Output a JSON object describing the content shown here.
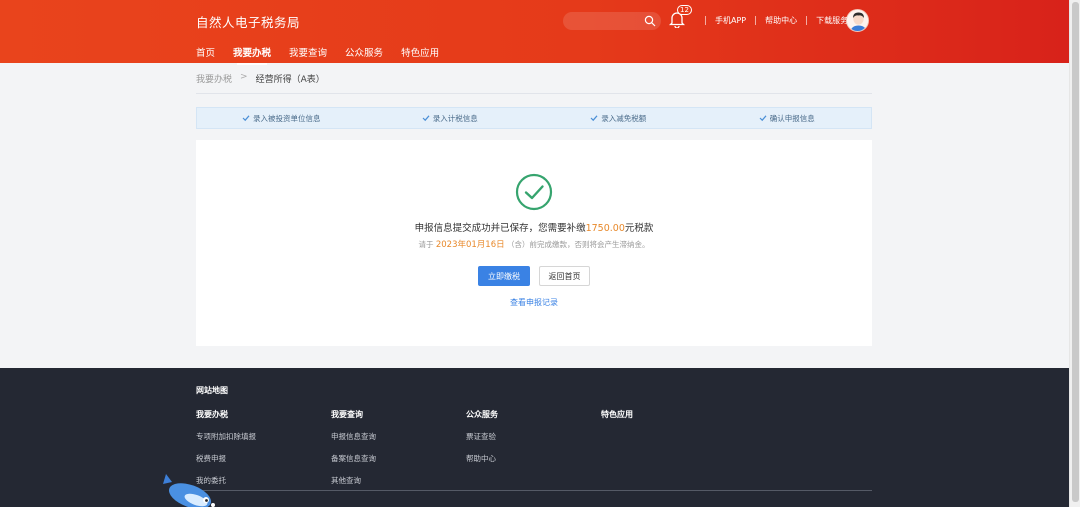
{
  "header": {
    "brand": "自然人电子税务局",
    "notification_count": "12",
    "links": [
      "手机APP",
      "帮助中心",
      "下载服务"
    ],
    "nav": [
      "首页",
      "我要办税",
      "我要查询",
      "公众服务",
      "特色应用"
    ],
    "active_nav": "我要办税"
  },
  "breadcrumb": {
    "parent": "我要办税",
    "current": "经营所得（A表）"
  },
  "steps": [
    "录入被投资单位信息",
    "录入计税信息",
    "录入减免税额",
    "确认申报信息"
  ],
  "result": {
    "msg_prefix": "申报信息提交成功并已保存，您需要补缴",
    "amount": "1750.00",
    "msg_suffix": "元税款",
    "note_prefix": "请于",
    "deadline": "2023年01月16日",
    "note_suffix": "（含）前完成缴款，否则将会产生滞纳金。",
    "pay_button": "立即缴税",
    "home_button": "返回首页",
    "view_records": "查看申报记录"
  },
  "footer": {
    "title": "网站地图",
    "columns": [
      {
        "heading": "我要办税",
        "links": [
          "专项附加扣除填报",
          "税费申报",
          "我的委托"
        ]
      },
      {
        "heading": "我要查询",
        "links": [
          "申报信息查询",
          "备案信息查询",
          "其他查询"
        ]
      },
      {
        "heading": "公众服务",
        "links": [
          "票证查验",
          "帮助中心"
        ]
      },
      {
        "heading": "特色应用",
        "links": []
      }
    ]
  },
  "colors": {
    "header_red": "#e53a1a",
    "primary_blue": "#3a82e4",
    "success_green": "#36a46e",
    "amount_orange": "#e8892b",
    "footer_bg": "#242833"
  }
}
